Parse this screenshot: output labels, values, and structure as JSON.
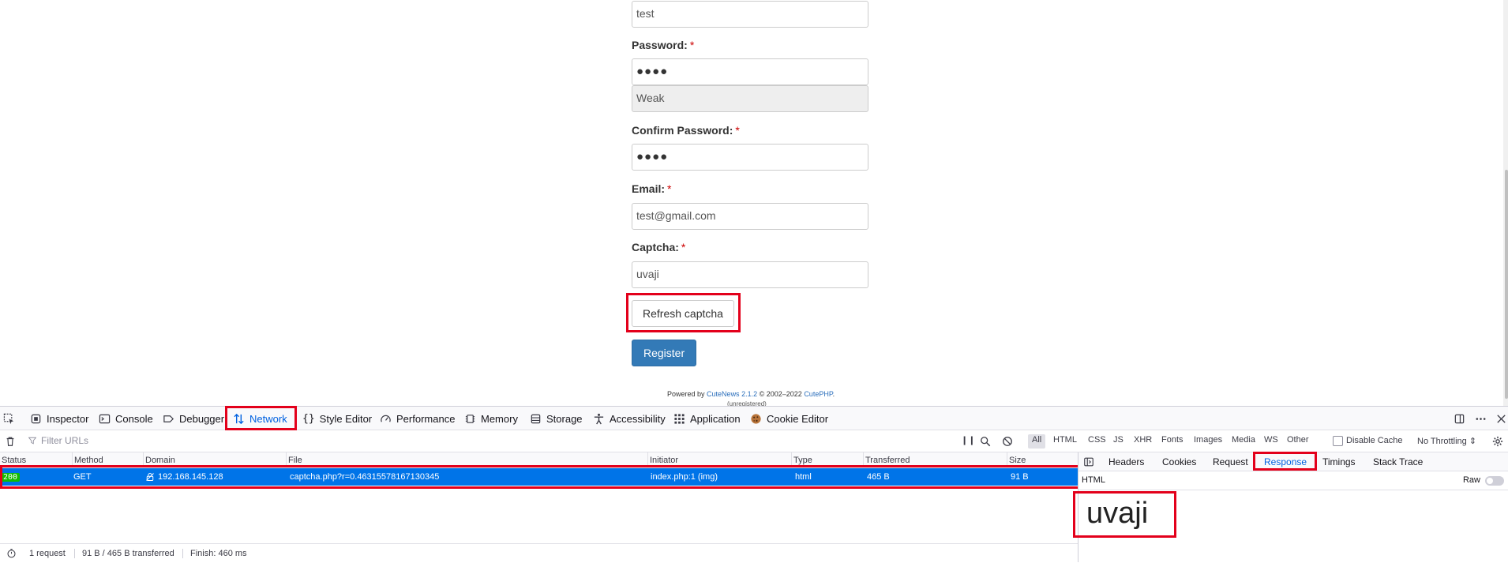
{
  "form": {
    "username_value": "test",
    "password_label": "Password:",
    "password_value": "●●●●",
    "strength_text": "Weak",
    "confirm_label": "Confirm Password:",
    "confirm_value": "●●●●",
    "email_label": "Email:",
    "email_value": "test@gmail.com",
    "captcha_label": "Captcha:",
    "captcha_value": "uvaji",
    "required_mark": "*",
    "refresh_button": "Refresh captcha",
    "register_button": "Register"
  },
  "footer": {
    "powered_by": "Powered by",
    "cutenews_link": "CuteNews 2.1.2",
    "copyright": "© 2002–2022",
    "cutephp_link": "CutePHP",
    "period": ".",
    "unregistered": "(unregistered)"
  },
  "devtools": {
    "tabs": [
      "Inspector",
      "Console",
      "Debugger",
      "Network",
      "Style Editor",
      "Performance",
      "Memory",
      "Storage",
      "Accessibility",
      "Application",
      "Cookie Editor"
    ],
    "active_tab": "Network",
    "filter_placeholder": "Filter URLs",
    "type_filters": [
      "All",
      "HTML",
      "CSS",
      "JS",
      "XHR",
      "Fonts",
      "Images",
      "Media",
      "WS",
      "Other"
    ],
    "disable_cache": "Disable Cache",
    "throttling": "No Throttling ⇕",
    "columns": [
      "Status",
      "Method",
      "Domain",
      "File",
      "Initiator",
      "Type",
      "Transferred",
      "Size"
    ],
    "request": {
      "status": "200",
      "method": "GET",
      "domain": "192.168.145.128",
      "file": "captcha.php?r=0.46315578167130345",
      "initiator": "index.php:1 (img)",
      "type": "html",
      "transferred": "465 B",
      "size": "91 B"
    },
    "status_bar": {
      "requests": "1 request",
      "transferred": "91 B / 465 B transferred",
      "finish": "Finish: 460 ms"
    },
    "side_tabs": [
      "Headers",
      "Cookies",
      "Request",
      "Response",
      "Timings",
      "Stack Trace"
    ],
    "active_side_tab": "Response",
    "response_format": "HTML",
    "raw_label": "Raw",
    "response_body": "uvaji"
  },
  "colors": {
    "highlight": "#e3001b",
    "devtools_accent": "#0061e0",
    "selected_row": "#0074e8",
    "register_button": "#337ab7"
  }
}
